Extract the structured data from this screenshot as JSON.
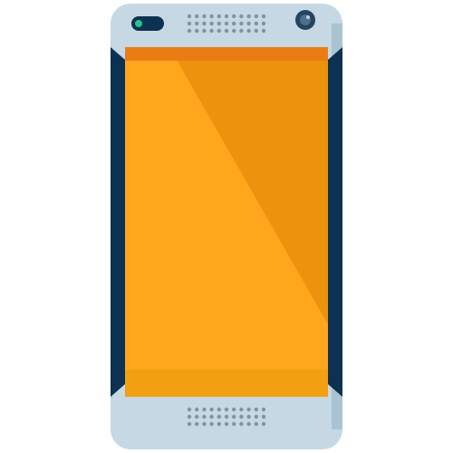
{
  "illustration": {
    "subject": "smartphone",
    "colors": {
      "body": "#c5d8e4",
      "body_shade": "#a9c3d3",
      "side_panel": "#0d3152",
      "screen": "#eb930c",
      "screen_light": "#ffa61c",
      "status_bar": "#ea7c16",
      "bottom_bar": "#f2a012",
      "speaker_dot": "#7f93a3",
      "camera_ring": "#25435f",
      "camera_lens": "#4c6f8c",
      "camera_glint": "#b9d3e3",
      "sensor_body": "#0d3152",
      "sensor_led": "#25c58a"
    }
  }
}
